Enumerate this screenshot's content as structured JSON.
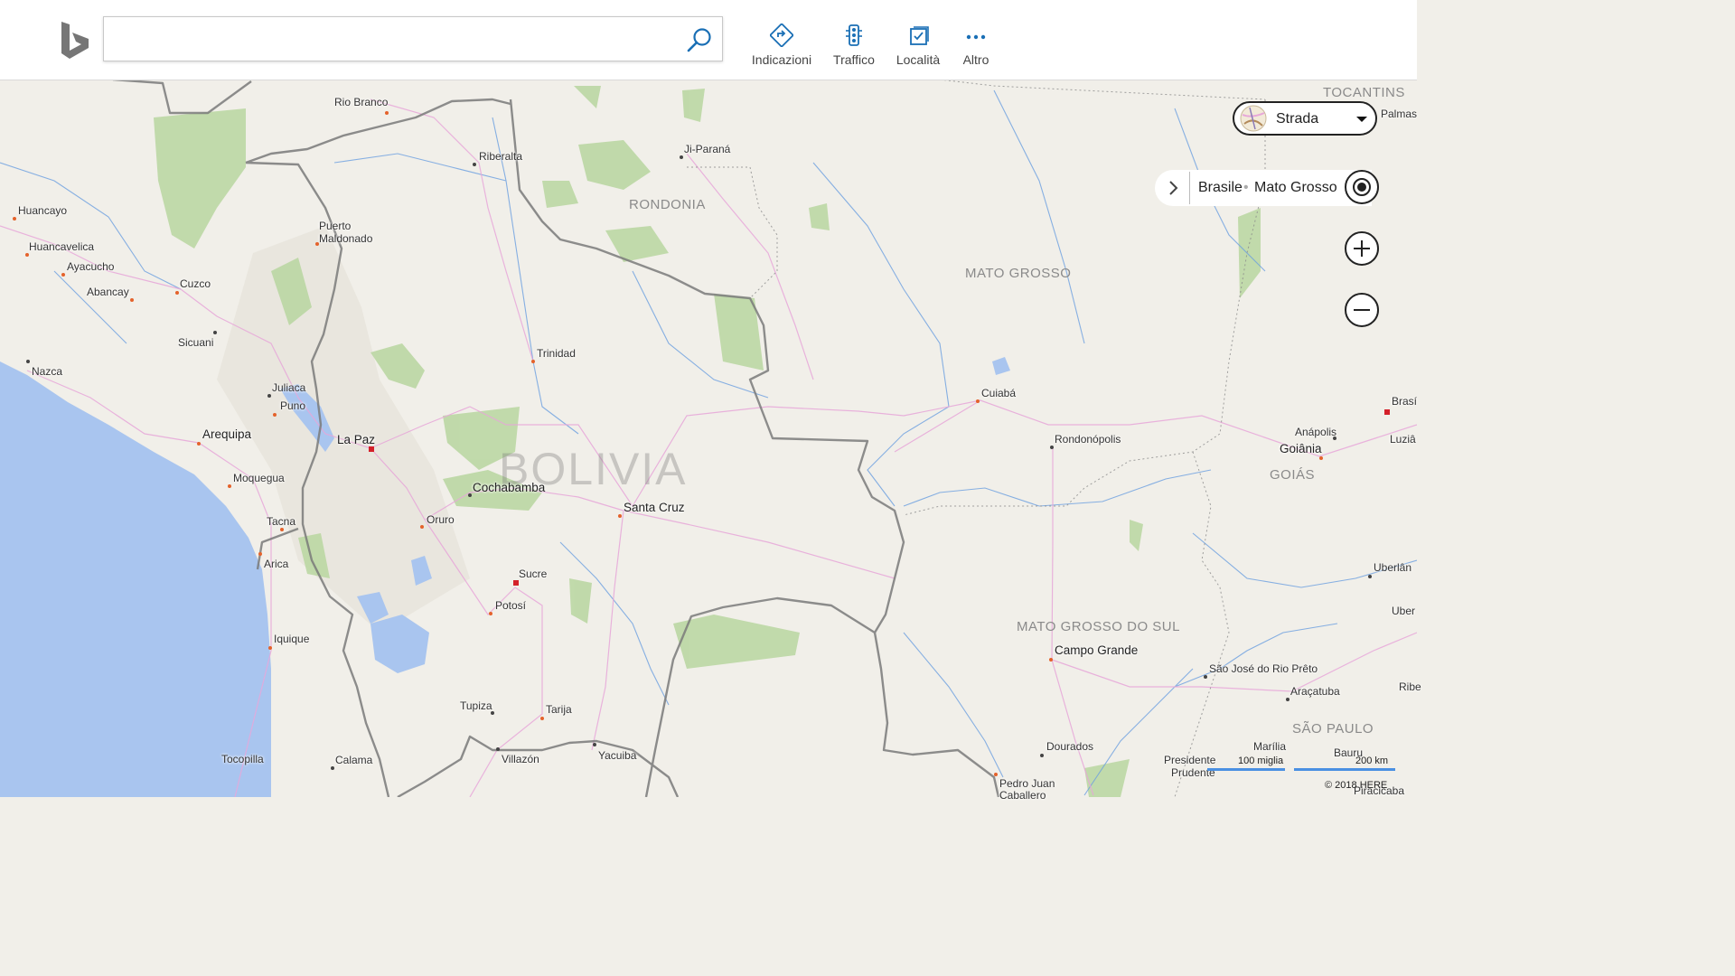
{
  "toolbar": {
    "search_placeholder": "",
    "buttons": [
      {
        "label": "Indicazioni",
        "icon": "directions-icon"
      },
      {
        "label": "Traffico",
        "icon": "traffic-icon"
      },
      {
        "label": "Località",
        "icon": "places-icon"
      },
      {
        "label": "Altro",
        "icon": "more-icon"
      }
    ]
  },
  "map_controls": {
    "style_label": "Strada",
    "breadcrumb": [
      "Brasile",
      "Mato Grosso"
    ],
    "breadcrumb_separator": "•",
    "scale_miles": "100 miglia",
    "scale_km": "200 km",
    "copyright": "© 2018 HERE"
  },
  "map": {
    "country_label": "BOLIVIA",
    "regions": [
      "RONDONIA",
      "MATO GROSSO",
      "TOCANTINS",
      "GOIÁS",
      "MATO GROSSO DO SUL",
      "SÃO PAULO"
    ],
    "places": [
      "Rio Branco",
      "Ji-Paraná",
      "Riberalta",
      "Huancayo",
      "Puerto",
      "Maldonado",
      "Huancavelica",
      "Ayacucho",
      "Abancay",
      "Cuzco",
      "Sicuani",
      "Nazca",
      "Juliaca",
      "Puno",
      "Arequipa",
      "La Paz",
      "Moquegua",
      "Tacna",
      "Arica",
      "Iquique",
      "Tocopilla",
      "Calama",
      "Villazón",
      "Tupiza",
      "Tarija",
      "Yacuiba",
      "Potosí",
      "Sucre",
      "Oruro",
      "Cochabamba",
      "Santa Cruz",
      "Trinidad",
      "Cuiabá",
      "Rondonópolis",
      "Anápolis",
      "Goiânia",
      "Campo Grande",
      "Dourados",
      "Pedro Juan",
      "Caballero",
      "Presidente",
      "Prudente",
      "Marília",
      "Bauru",
      "Araçatuba",
      "São José do Rio Prêto",
      "Uberlân",
      "Uber",
      "Ribe",
      "Brasí",
      "Luziâ",
      "Palmas",
      "Piracicaba"
    ]
  },
  "colors": {
    "ocean": "#a9c5ef",
    "land": "#f1efe9",
    "forest": "#b8d6a0",
    "border": "#7d7d7d",
    "accent": "#1f6fb2"
  }
}
